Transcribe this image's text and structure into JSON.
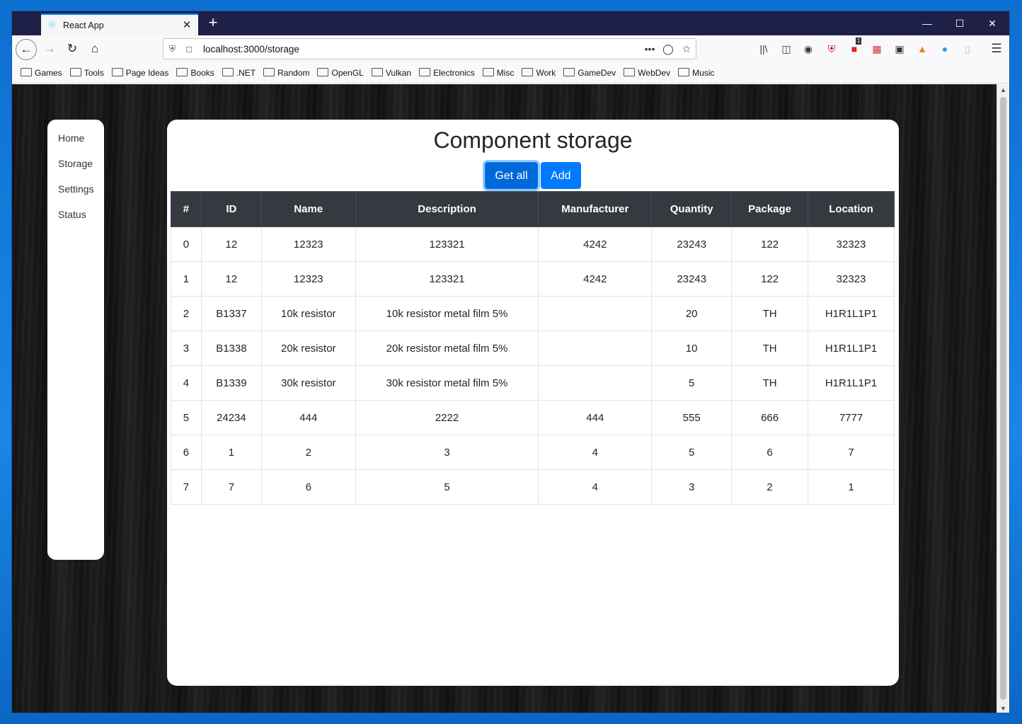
{
  "browser": {
    "tab_title": "React App",
    "url": "localhost:3000/storage",
    "bookmarks": [
      "Games",
      "Tools",
      "Page Ideas",
      "Books",
      ".NET",
      "Random",
      "OpenGL",
      "Vulkan",
      "Electronics",
      "Misc",
      "Work",
      "GameDev",
      "WebDev",
      "Music"
    ],
    "extension_badge": "1"
  },
  "sidebar": {
    "items": [
      {
        "label": "Home"
      },
      {
        "label": "Storage"
      },
      {
        "label": "Settings"
      },
      {
        "label": "Status"
      }
    ]
  },
  "main": {
    "title": "Component storage",
    "get_all_label": "Get all",
    "add_label": "Add",
    "table": {
      "headers": [
        "#",
        "ID",
        "Name",
        "Description",
        "Manufacturer",
        "Quantity",
        "Package",
        "Location"
      ],
      "rows": [
        [
          "0",
          "12",
          "12323",
          "123321",
          "4242",
          "23243",
          "122",
          "32323"
        ],
        [
          "1",
          "12",
          "12323",
          "123321",
          "4242",
          "23243",
          "122",
          "32323"
        ],
        [
          "2",
          "B1337",
          "10k resistor",
          "10k resistor metal film 5%",
          "",
          "20",
          "TH",
          "H1R1L1P1"
        ],
        [
          "3",
          "B1338",
          "20k resistor",
          "20k resistor metal film 5%",
          "",
          "10",
          "TH",
          "H1R1L1P1"
        ],
        [
          "4",
          "B1339",
          "30k resistor",
          "30k resistor metal film 5%",
          "",
          "5",
          "TH",
          "H1R1L1P1"
        ],
        [
          "5",
          "24234",
          "444",
          "2222",
          "444",
          "555",
          "666",
          "7777"
        ],
        [
          "6",
          "1",
          "2",
          "3",
          "4",
          "5",
          "6",
          "7"
        ],
        [
          "7",
          "7",
          "6",
          "5",
          "4",
          "3",
          "2",
          "1"
        ]
      ]
    }
  },
  "colors": {
    "primary": "#007bff",
    "table_header": "#343a40",
    "tabbar": "#1f2047"
  }
}
